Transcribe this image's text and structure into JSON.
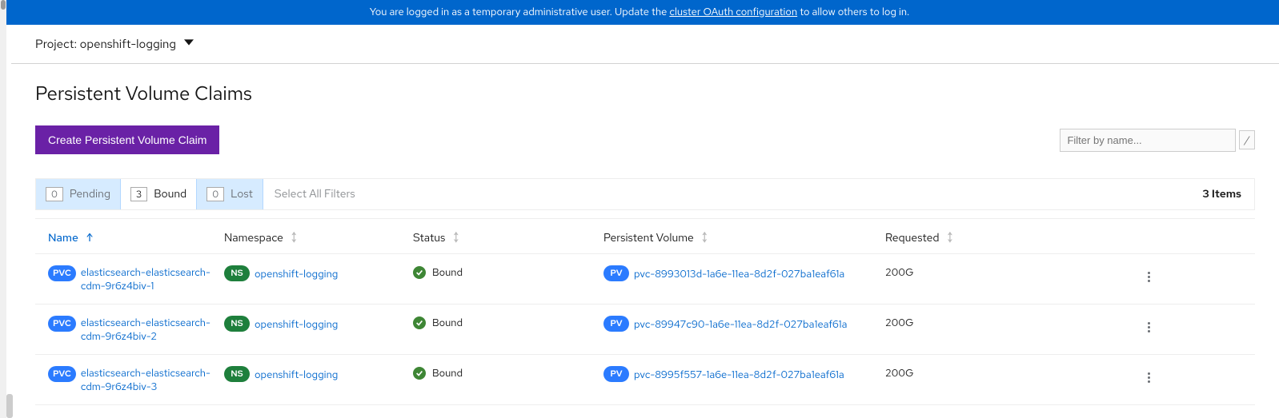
{
  "banner": {
    "prefix": "You are logged in as a temporary administrative user. Update the ",
    "link": "cluster OAuth configuration",
    "suffix": " to allow others to log in."
  },
  "project": {
    "label": "Project: openshift-logging"
  },
  "page": {
    "title": "Persistent Volume Claims",
    "create_button": "Create Persistent Volume Claim",
    "filter_placeholder": "Filter by name...",
    "filter_key": "/"
  },
  "status_filters": {
    "pending": {
      "count": "0",
      "label": "Pending"
    },
    "bound": {
      "count": "3",
      "label": "Bound"
    },
    "lost": {
      "count": "0",
      "label": "Lost"
    },
    "select_all": "Select All Filters",
    "items_count": "3 Items"
  },
  "columns": {
    "name": "Name",
    "namespace": "Namespace",
    "status": "Status",
    "pv": "Persistent Volume",
    "requested": "Requested"
  },
  "badges": {
    "pvc": "PVC",
    "ns": "NS",
    "pv": "PV"
  },
  "rows": [
    {
      "name": "elasticsearch-elasticsearch-cdm-9r6z4biv-1",
      "namespace": "openshift-logging",
      "status": "Bound",
      "pv": "pvc-8993013d-1a6e-11ea-8d2f-027ba1eaf61a",
      "requested": "200G"
    },
    {
      "name": "elasticsearch-elasticsearch-cdm-9r6z4biv-2",
      "namespace": "openshift-logging",
      "status": "Bound",
      "pv": "pvc-89947c90-1a6e-11ea-8d2f-027ba1eaf61a",
      "requested": "200G"
    },
    {
      "name": "elasticsearch-elasticsearch-cdm-9r6z4biv-3",
      "namespace": "openshift-logging",
      "status": "Bound",
      "pv": "pvc-8995f557-1a6e-11ea-8d2f-027ba1eaf61a",
      "requested": "200G"
    }
  ]
}
